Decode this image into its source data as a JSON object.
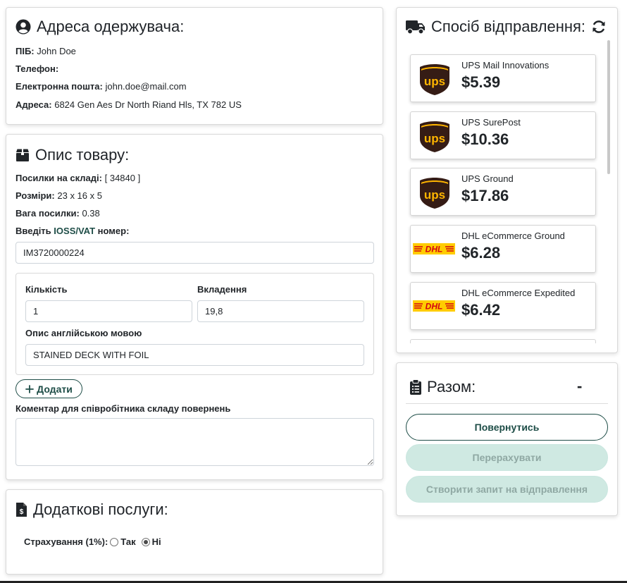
{
  "recipient": {
    "title": "Адреса одержувача:",
    "name_label": "ПІБ:",
    "name_value": "John Doe",
    "phone_label": "Телефон:",
    "phone_value": "",
    "email_label": "Електронна пошта:",
    "email_value": "john.doe@mail.com",
    "address_label": "Адреса:",
    "address_value": "6824 Gen Aes Dr North Riand Hls, TX 782 US"
  },
  "product": {
    "title": "Опис товару:",
    "warehouse_label": "Посилки на складі:",
    "warehouse_value": "[ 34840 ]",
    "size_label": "Розміри:",
    "size_value": "23 x 16 x 5",
    "weight_label": "Вага посилки:",
    "weight_value": "0.38",
    "ioss_prefix": "Введіть",
    "ioss_link": "IOSS/VAT",
    "ioss_suffix": "номер:",
    "ioss_value": "IM3720000224",
    "item": {
      "qty_label": "Кількість",
      "qty_value": "1",
      "attach_label": "Вкладення",
      "attach_value": "19,8",
      "desc_label": "Опис англійською мовою",
      "desc_value": "STAINED DECK WITH FOIL"
    },
    "add_label": "Додати",
    "comment_label": "Коментар для співробітника складу повернень",
    "comment_value": ""
  },
  "extra": {
    "title": "Додаткові послуги:",
    "insurance_label": "Страхування (1%):",
    "yes_label": "Так",
    "no_label": "Ні",
    "selected": "no"
  },
  "shipping": {
    "title": "Спосіб відправлення:",
    "options": [
      {
        "carrier": "ups-logo",
        "name": "UPS Mail Innovations",
        "price": "$5.39"
      },
      {
        "carrier": "ups-logo",
        "name": "UPS SurePost",
        "price": "$10.36"
      },
      {
        "carrier": "ups-logo",
        "name": "UPS Ground",
        "price": "$17.86"
      },
      {
        "carrier": "dhl-logo",
        "name": "DHL eCommerce Ground",
        "price": "$6.28"
      },
      {
        "carrier": "dhl-logo",
        "name": "DHL eCommerce Expedited",
        "price": "$6.42"
      }
    ]
  },
  "total": {
    "title": "Разом:",
    "value": "-",
    "back_label": "Повернутись",
    "recalc_label": "Перерахувати",
    "create_label": "Створити запит на відправлення"
  },
  "colors": {
    "accent": "#1e4d47",
    "soft_button": "#cfe9e2",
    "ups_brown": "#351c15",
    "ups_gold": "#ffb500",
    "dhl_yellow": "#ffcc00",
    "dhl_red": "#d40511"
  },
  "icons": [
    "user-circle-icon",
    "box-icon",
    "receipt-dollar-icon",
    "truck-icon",
    "refresh-icon",
    "clipboard-list-icon",
    "plus-icon"
  ]
}
